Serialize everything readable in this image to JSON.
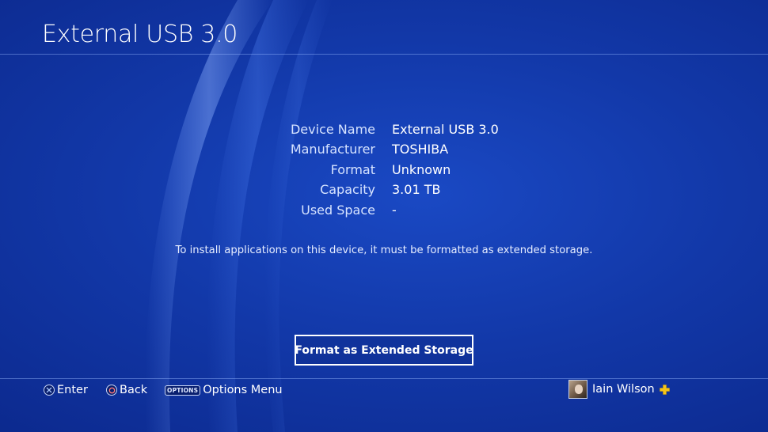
{
  "page": {
    "title": "External USB 3.0"
  },
  "device_info": {
    "rows": [
      {
        "label": "Device Name",
        "value": "External USB 3.0"
      },
      {
        "label": "Manufacturer",
        "value": "TOSHIBA"
      },
      {
        "label": "Format",
        "value": "Unknown"
      },
      {
        "label": "Capacity",
        "value": "3.01 TB"
      },
      {
        "label": "Used Space",
        "value": "-"
      }
    ]
  },
  "notice": "To install applications on this device, it must be formatted as extended storage.",
  "actions": {
    "format_button_label": "Format as Extended Storage"
  },
  "footer": {
    "hints": [
      {
        "icon": "cross-button-icon",
        "label": "Enter"
      },
      {
        "icon": "circle-button-icon",
        "label": "Back"
      },
      {
        "icon": "options-button-icon",
        "glyph": "OPTIONS",
        "label": "Options Menu"
      }
    ],
    "user": {
      "name": "Iain Wilson",
      "badge_icon": "playstation-plus-icon"
    }
  },
  "colors": {
    "background": "#1238a8",
    "text": "#ffffff",
    "plus_badge": "#f5c518"
  }
}
